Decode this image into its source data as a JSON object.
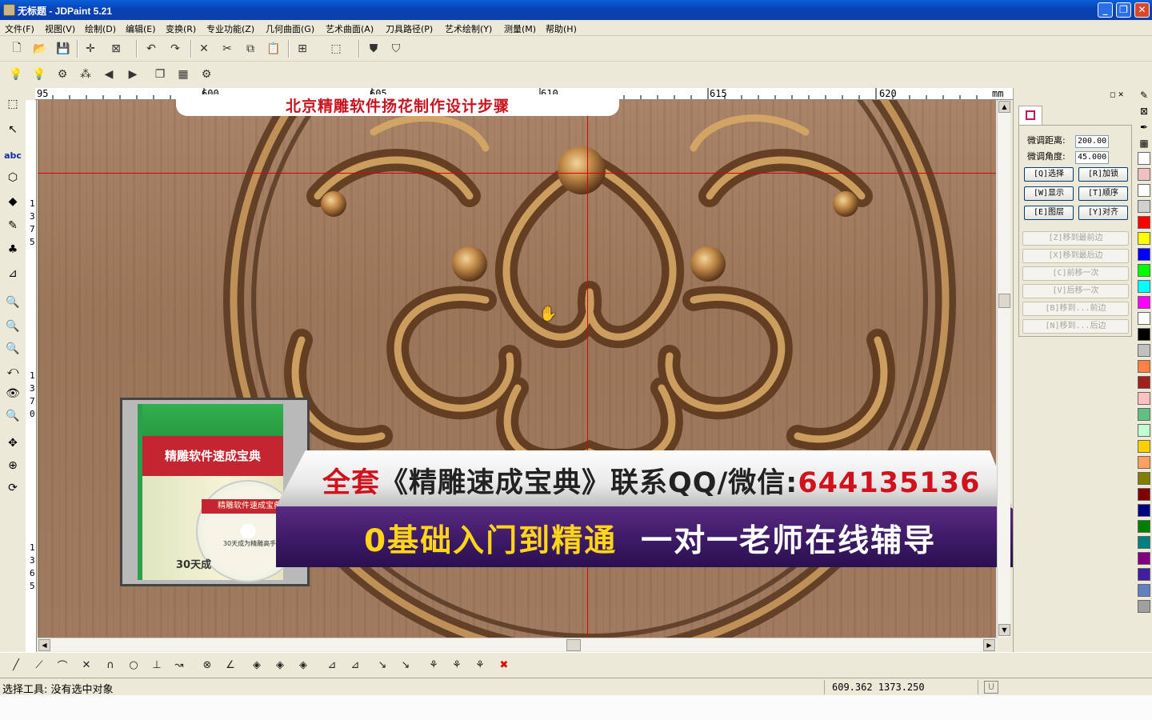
{
  "window": {
    "title": "无标题 - JDPaint 5.21",
    "buttons": {
      "min": "_",
      "max": "❐",
      "close": "✕"
    }
  },
  "menu": [
    "文件(F)",
    "视图(V)",
    "绘制(D)",
    "编辑(E)",
    "变换(R)",
    "专业功能(Z)",
    "几何曲面(G)",
    "艺术曲面(A)",
    "刀具路径(P)",
    "艺术绘制(Y)",
    "测量(M)",
    "帮助(H)"
  ],
  "toolbar1": [
    {
      "name": "new-file-icon",
      "glyph": "🗋"
    },
    {
      "name": "open-file-icon",
      "glyph": "📂"
    },
    {
      "name": "save-icon",
      "glyph": "💾"
    },
    {
      "name": "crosshair-icon",
      "glyph": "✛"
    },
    {
      "name": "select-box-icon",
      "glyph": "⊠"
    },
    {
      "name": "undo-icon",
      "glyph": "↶"
    },
    {
      "name": "redo-icon",
      "glyph": "↷"
    },
    {
      "name": "delete-icon",
      "glyph": "✕"
    },
    {
      "name": "cut-icon",
      "glyph": "✂"
    },
    {
      "name": "copy-icon",
      "glyph": "⧉"
    },
    {
      "name": "paste-icon",
      "glyph": "📋"
    },
    {
      "name": "grid-icon",
      "glyph": "⊞"
    },
    {
      "name": "view3d-icon",
      "glyph": "⬚"
    },
    {
      "name": "shield-a-icon",
      "glyph": "⛊"
    },
    {
      "name": "shield-b-icon",
      "glyph": "⛉"
    }
  ],
  "toolbar2": [
    {
      "name": "bulb-green-icon",
      "glyph": "💡"
    },
    {
      "name": "bulb-yellow-icon",
      "glyph": "💡"
    },
    {
      "name": "layer-icon",
      "glyph": "⚙"
    },
    {
      "name": "nodes-icon",
      "glyph": "⁂"
    },
    {
      "name": "back-icon",
      "glyph": "◀"
    },
    {
      "name": "forward-icon",
      "glyph": "▶"
    },
    {
      "name": "pages-icon",
      "glyph": "❐"
    },
    {
      "name": "grid-dots-icon",
      "glyph": "▦"
    },
    {
      "name": "gear-icon",
      "glyph": "⚙"
    }
  ],
  "ruler": {
    "top_labels": [
      "95",
      "600",
      "605",
      "610",
      "615",
      "620",
      "mm"
    ],
    "left_labels": [
      "1375",
      "1370",
      "1365"
    ]
  },
  "left_tools": [
    {
      "name": "select-tool-icon",
      "glyph": "⬚"
    },
    {
      "name": "node-edit-icon",
      "glyph": "↖"
    },
    {
      "name": "text-tool-icon",
      "glyph": "abc"
    },
    {
      "name": "shape-tool-icon",
      "glyph": "⬡"
    },
    {
      "name": "fill-tool-icon",
      "glyph": "◆"
    },
    {
      "name": "pen-tool-icon",
      "glyph": "✎"
    },
    {
      "name": "tree-tool-icon",
      "glyph": "♣"
    },
    {
      "name": "measure-tool-icon",
      "glyph": "⊿"
    },
    {
      "name": "zoom-window-icon",
      "glyph": "🔍"
    },
    {
      "name": "zoom-out-icon",
      "glyph": "🔍"
    },
    {
      "name": "zoom-in-icon",
      "glyph": "🔍"
    },
    {
      "name": "zoom-prev-icon",
      "glyph": "⤺"
    },
    {
      "name": "eye-icon",
      "glyph": "👁"
    },
    {
      "name": "zoom-fit-icon",
      "glyph": "🔍"
    },
    {
      "name": "pan-icon",
      "glyph": "✥"
    },
    {
      "name": "zoom-all-icon",
      "glyph": "⊕"
    },
    {
      "name": "rotate-view-icon",
      "glyph": "⟳"
    }
  ],
  "canvas": {
    "banner": "北京精雕软件扬花制作设计步骤",
    "promo": {
      "book_title": "精雕软件速成宝典",
      "cd_title": "精雕软件速成宝典",
      "cd_sub": "30天成为精雕高手",
      "book_bottom": "30天成",
      "line1_prefix": "全套",
      "line1_main": "《精雕速成宝典》联系QQ/微信:",
      "line1_number": "644135136",
      "line2_left": "0基础入门到精通",
      "line2_right": "一对一老师在线辅导"
    }
  },
  "right_panel": {
    "fields": [
      {
        "label": "微调距离:",
        "value": "200.00"
      },
      {
        "label": "微调角度:",
        "value": "45.000"
      }
    ],
    "buttons": [
      "[Q]选择",
      "[R]加锁",
      "[W]显示",
      "[T]顺序",
      "[E]图层",
      "[Y]对齐"
    ],
    "wide_buttons": [
      "[Z]移到最前边",
      "[X]移到最后边",
      "[C]前移一次",
      "[V]后移一次",
      "[B]移到...前边",
      "[N]移到...后边"
    ]
  },
  "palette": [
    "#ffffff",
    "#f0c0c0",
    "#ffffff",
    "#d0d0d0",
    "#ff0000",
    "#ffff00",
    "#0000ff",
    "#00ff00",
    "#00ffff",
    "#ff00ff",
    "#ffffff",
    "#000000",
    "#c0c0c0",
    "#ff8040",
    "#a02020",
    "#ffc0c0",
    "#60c080",
    "#c0ffd0",
    "#ffd000",
    "#ffa060",
    "#808000",
    "#800000",
    "#000080",
    "#008000",
    "#008080",
    "#800080",
    "#4020a0",
    "#6080c0",
    "#a0a0a0"
  ],
  "bottom_tools": [
    {
      "name": "line-icon",
      "glyph": "╱"
    },
    {
      "name": "polyline-icon",
      "glyph": "⟋"
    },
    {
      "name": "arc-icon",
      "glyph": "⌒"
    },
    {
      "name": "cross-icon",
      "glyph": "✕"
    },
    {
      "name": "curve-icon",
      "glyph": "∩"
    },
    {
      "name": "circle-icon",
      "glyph": "○"
    },
    {
      "name": "perpendicular-icon",
      "glyph": "⊥"
    },
    {
      "name": "tangent-icon",
      "glyph": "↝"
    },
    {
      "name": "snap-point-icon",
      "glyph": "⊗"
    },
    {
      "name": "angle-icon",
      "glyph": "∠"
    },
    {
      "name": "diamond-a-icon",
      "glyph": "◈"
    },
    {
      "name": "diamond-b-icon",
      "glyph": "◈"
    },
    {
      "name": "diamond-c-icon",
      "glyph": "◈"
    },
    {
      "name": "align-a-icon",
      "glyph": "⊿"
    },
    {
      "name": "align-b-icon",
      "glyph": "⊿"
    },
    {
      "name": "pick-a-icon",
      "glyph": "↘"
    },
    {
      "name": "pick-b-icon",
      "glyph": "↘"
    },
    {
      "name": "trim-a-icon",
      "glyph": "⚘"
    },
    {
      "name": "trim-b-icon",
      "glyph": "⚘"
    },
    {
      "name": "trim-c-icon",
      "glyph": "⚘"
    },
    {
      "name": "cancel-icon",
      "glyph": "✖"
    }
  ],
  "status": {
    "text": "选择工具: 没有选中对象",
    "coords": "609.362 1373.250",
    "unit_box": "U"
  }
}
